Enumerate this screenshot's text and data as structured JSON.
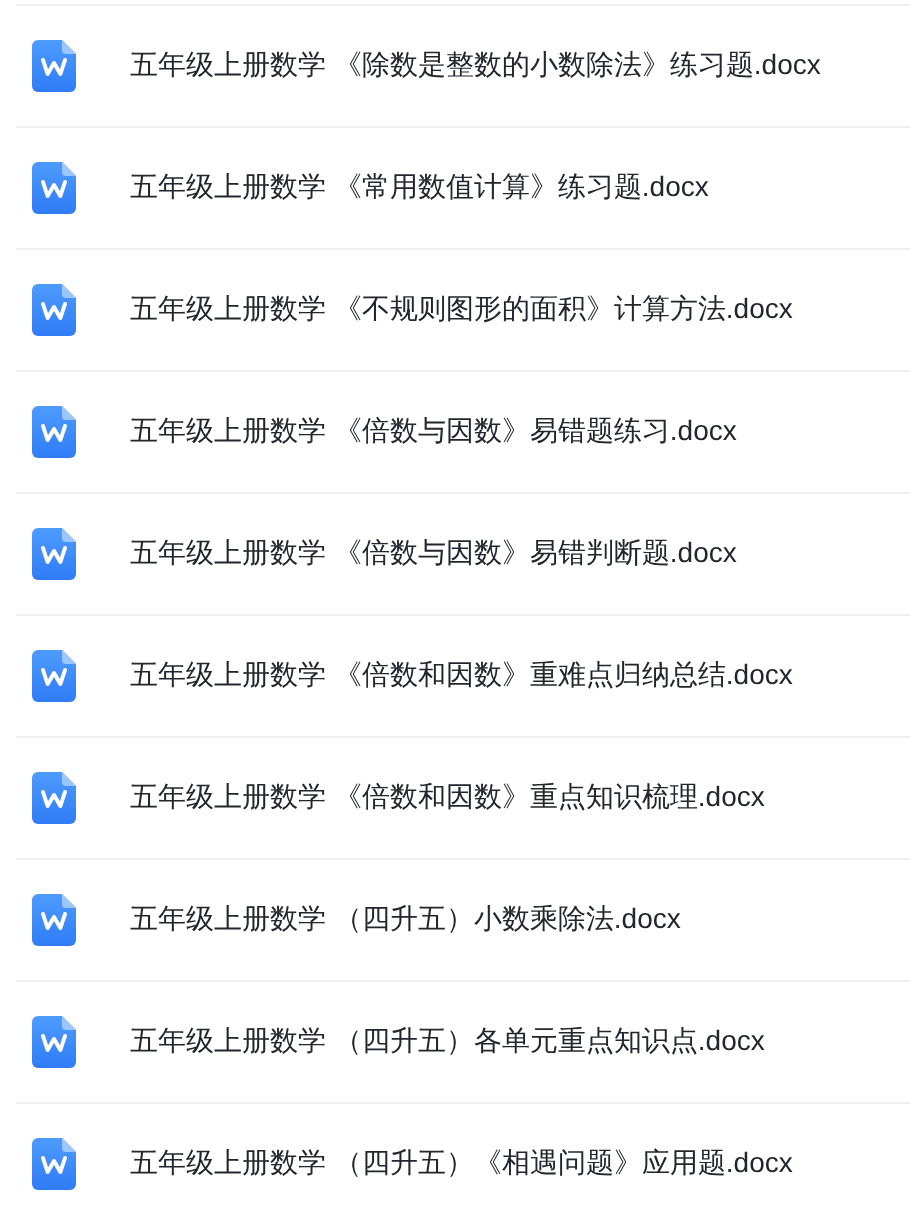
{
  "files": [
    {
      "name": "五年级上册数学 《除数是整数的小数除法》练习题.docx",
      "kind": "word"
    },
    {
      "name": "五年级上册数学 《常用数值计算》练习题.docx",
      "kind": "word"
    },
    {
      "name": "五年级上册数学 《不规则图形的面积》计算方法.docx",
      "kind": "word"
    },
    {
      "name": "五年级上册数学 《倍数与因数》易错题练习.docx",
      "kind": "word"
    },
    {
      "name": "五年级上册数学 《倍数与因数》易错判断题.docx",
      "kind": "word"
    },
    {
      "name": "五年级上册数学 《倍数和因数》重难点归纳总结.docx",
      "kind": "word"
    },
    {
      "name": "五年级上册数学 《倍数和因数》重点知识梳理.docx",
      "kind": "word"
    },
    {
      "name": "五年级上册数学 （四升五）小数乘除法.docx",
      "kind": "word"
    },
    {
      "name": "五年级上册数学 （四升五）各单元重点知识点.docx",
      "kind": "word"
    },
    {
      "name": "五年级上册数学 （四升五）《相遇问题》应用题.docx",
      "kind": "word"
    }
  ]
}
